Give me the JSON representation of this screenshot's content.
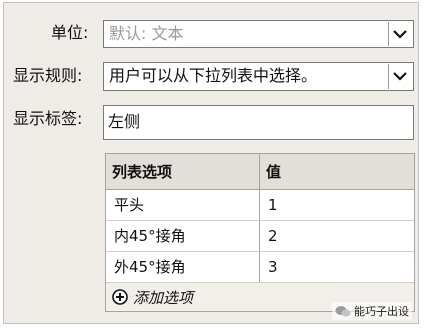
{
  "form": {
    "unit": {
      "label": "单位:",
      "value": "默认: 文本"
    },
    "display_rule": {
      "label": "显示规则:",
      "value": "用户可以从下拉列表中选择。"
    },
    "display_label": {
      "label": "显示标签:",
      "value": "左侧"
    }
  },
  "options_table": {
    "headers": [
      "列表选项",
      "值"
    ],
    "rows": [
      {
        "option": "平头",
        "value": "1"
      },
      {
        "option": "内45°接角",
        "value": "2"
      },
      {
        "option": "外45°接角",
        "value": "3"
      }
    ],
    "add_label": "添加选项"
  },
  "watermark": {
    "text": "能巧子出设"
  },
  "icons": {
    "dropdown": "chevron-down-icon",
    "add": "plus-circle-icon",
    "watermark": "wechat-icon"
  }
}
